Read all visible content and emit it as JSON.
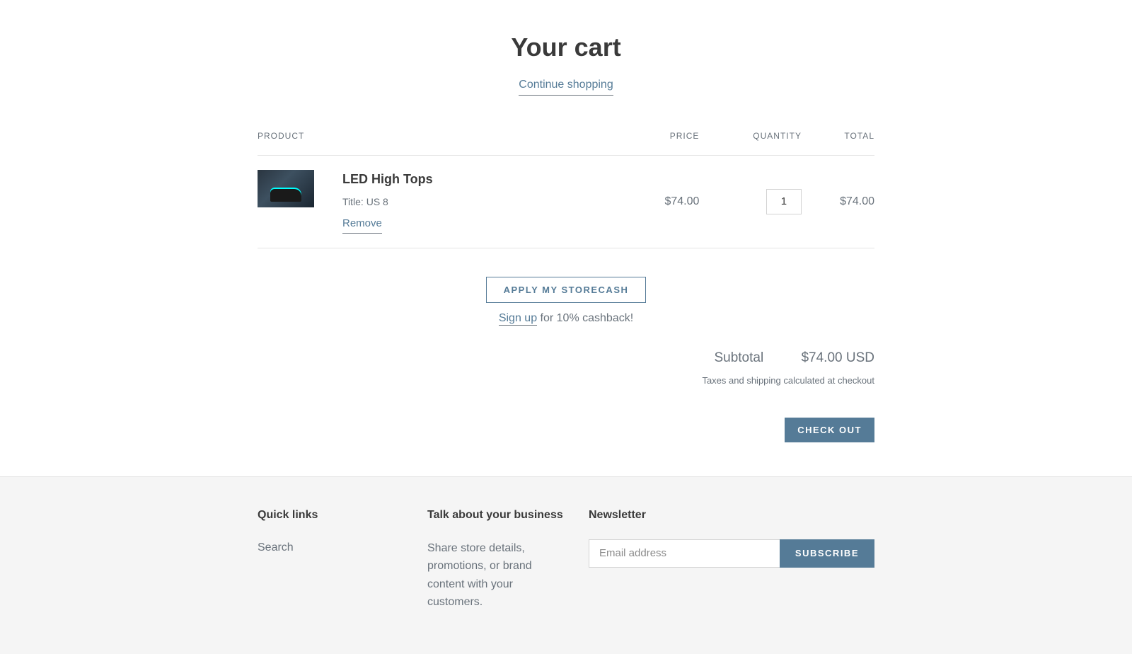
{
  "header": {
    "title": "Your cart",
    "continue_shopping": "Continue shopping"
  },
  "table": {
    "columns": {
      "product": "PRODUCT",
      "price": "PRICE",
      "quantity": "QUANTITY",
      "total": "TOTAL"
    }
  },
  "items": [
    {
      "name": "LED High Tops",
      "variant": "Title: US 8",
      "remove_label": "Remove",
      "price": "$74.00",
      "quantity": "1",
      "total": "$74.00"
    }
  ],
  "storecash": {
    "apply_label": "APPLY MY STORECASH",
    "signup_link": "Sign up",
    "signup_suffix": " for 10% cashback!"
  },
  "summary": {
    "subtotal_label": "Subtotal",
    "subtotal_value": "$74.00 USD",
    "taxes_note": "Taxes and shipping calculated at checkout",
    "checkout_label": "CHECK OUT"
  },
  "footer": {
    "quick_links_heading": "Quick links",
    "search_link": "Search",
    "business_heading": "Talk about your business",
    "business_text": "Share store details, promotions, or brand content with your customers.",
    "newsletter_heading": "Newsletter",
    "email_placeholder": "Email address",
    "subscribe_label": "SUBSCRIBE"
  }
}
